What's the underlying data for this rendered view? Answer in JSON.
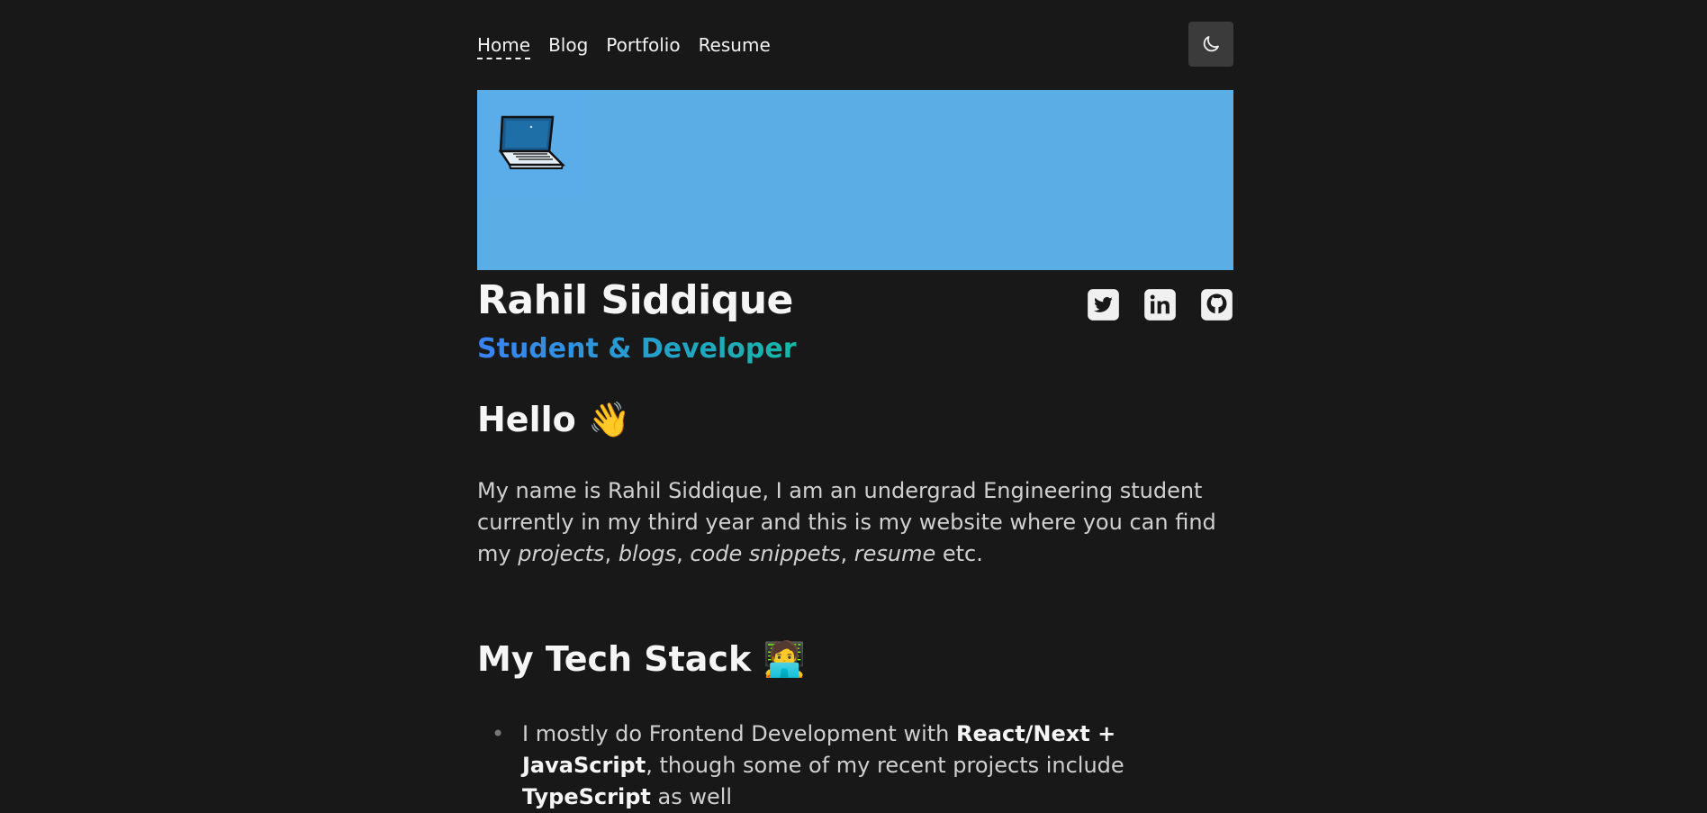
{
  "nav": {
    "items": [
      {
        "label": "Home",
        "active": true
      },
      {
        "label": "Blog"
      },
      {
        "label": "Portfolio"
      },
      {
        "label": "Resume"
      }
    ],
    "theme_icon": "moon-icon"
  },
  "banner": {
    "color": "#5aade5",
    "emoji": "💻"
  },
  "profile": {
    "name": "Rahil Siddique",
    "subtitle": "Student & Developer",
    "subtitle_gradient": [
      "#3b82f6",
      "#14b8a6"
    ],
    "socials": [
      {
        "icon": "twitter-icon"
      },
      {
        "icon": "linkedin-icon"
      },
      {
        "icon": "github-icon"
      }
    ]
  },
  "hello": {
    "heading": "Hello",
    "emoji": "👋"
  },
  "intro": {
    "text_1": "My name is Rahil Siddique, I am an undergrad Engineering student currently in my third year and this is my website where you can find my ",
    "italic_1": "projects",
    "sep_1": ", ",
    "italic_2": "blogs",
    "sep_2": ", ",
    "italic_3": "code snippets",
    "sep_3": ", ",
    "italic_4": "resume",
    "text_end": " etc."
  },
  "tech_stack": {
    "heading": "My Tech Stack",
    "emoji": "🧑‍💻",
    "item_1": {
      "bullet": "•",
      "text_1": "I mostly do Frontend Development with ",
      "bold_1": "React/Next + JavaScript",
      "text_2": ", though some of my recent projects include ",
      "bold_2": "TypeScript",
      "text_3": " as well"
    }
  }
}
